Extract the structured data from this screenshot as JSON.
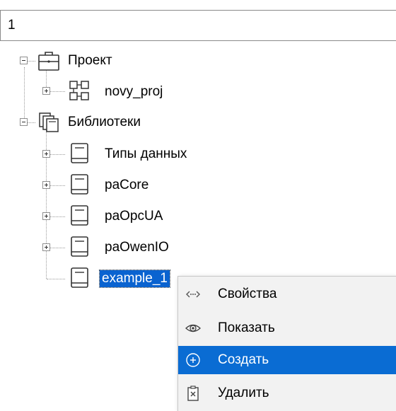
{
  "path_bar": {
    "value": "1"
  },
  "tree": {
    "nodes": [
      {
        "label": "Проект",
        "icon": "briefcase-icon"
      },
      {
        "label": "novy_proj",
        "icon": "project-network-icon"
      },
      {
        "label": "Библиотеки",
        "icon": "libraries-icon"
      },
      {
        "label": "Типы данных",
        "icon": "book-icon"
      },
      {
        "label": "paCore",
        "icon": "book-icon"
      },
      {
        "label": "paOpcUA",
        "icon": "book-icon"
      },
      {
        "label": "paOwenIO",
        "icon": "book-icon"
      },
      {
        "label": "example_1",
        "icon": "book-icon",
        "selected": true
      }
    ]
  },
  "context_menu": {
    "items": [
      {
        "label": "Свойства",
        "icon": "properties-arrows-icon"
      },
      {
        "label": "Показать",
        "icon": "eye-icon"
      },
      {
        "label": "Создать",
        "icon": "plus-circle-icon",
        "highlighted": true
      },
      {
        "label": "Удалить",
        "icon": "delete-icon"
      }
    ]
  },
  "colors": {
    "selection": "#0a63d0",
    "menu_highlight": "#0a6cd3",
    "menu_bg": "#f2f2f2"
  }
}
